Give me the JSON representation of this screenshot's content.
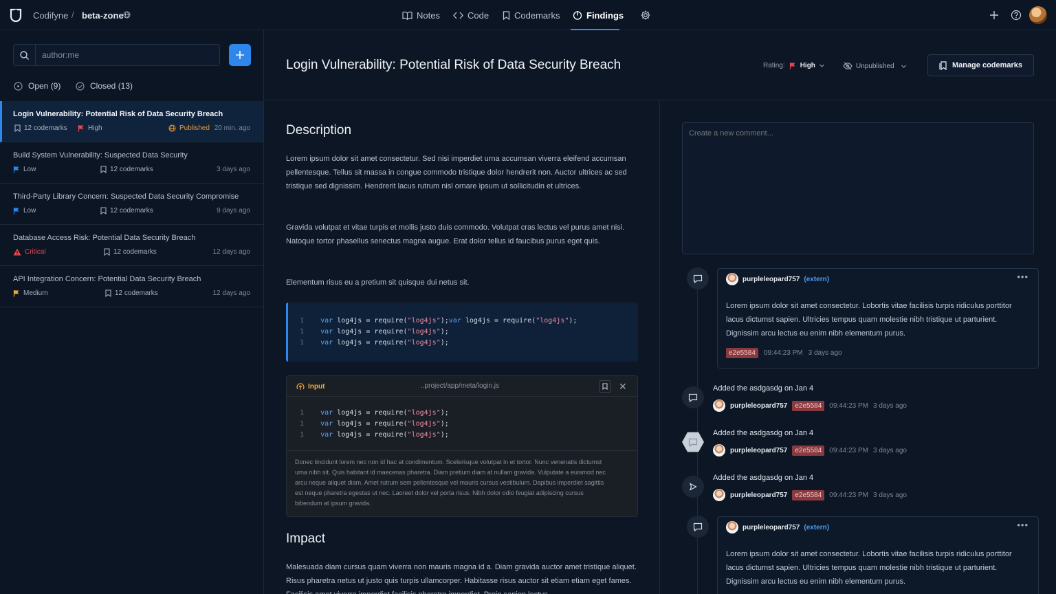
{
  "topbar": {
    "brand": "Codifyne",
    "separator": "/",
    "zone": "beta-zone",
    "nav": [
      {
        "label": "Notes",
        "icon": "book-icon"
      },
      {
        "label": "Code",
        "icon": "code-icon"
      },
      {
        "label": "Codemarks",
        "icon": "bookmark-icon"
      },
      {
        "label": "Findings",
        "icon": "findings-icon",
        "active": true
      }
    ]
  },
  "sidebar": {
    "search_value": "author:me",
    "filters": [
      {
        "label": "Open (9)"
      },
      {
        "label": "Closed (13)"
      }
    ],
    "findings": [
      {
        "title": "Login Vulnerability: Potential Risk of Data Security Breach",
        "codemarks": "12 codemarks",
        "severity": "High",
        "severity_color": "#e5484d",
        "status": "Published",
        "time": "20 min. ago"
      },
      {
        "title": "Build System Vulnerability: Suspected Data Security",
        "severity": "Low",
        "severity_color": "#2f86eb",
        "codemarks": "12 codemarks",
        "time": "3 days ago"
      },
      {
        "title": "Third-Party Library Concern: Suspected Data Security Compromise",
        "severity": "Low",
        "severity_color": "#2f86eb",
        "codemarks": "12 codemarks",
        "time": "9 days ago"
      },
      {
        "title": "Database Access Risk: Potential Data Security Breach",
        "severity": "Critical",
        "severity_color": "#e5484d",
        "codemarks": "12 codemarks",
        "time": "12 days ago"
      },
      {
        "title": "API Integration Concern: Potential Data Security Breach",
        "severity": "Medium",
        "severity_color": "#f2a93b",
        "codemarks": "12 codemarks",
        "time": "12 days ago"
      }
    ]
  },
  "header": {
    "title": "Login Vulnerability: Potential Risk of Data Security Breach",
    "rating_label": "Rating:",
    "rating_value": "High",
    "publish_state": "Unpublished",
    "manage_label": "Manage codemarks"
  },
  "content": {
    "description_heading": "Description",
    "paragraphs": [
      "Lorem ipsum dolor sit amet consectetur. Sed nisi imperdiet urna accumsan viverra eleifend accumsan pellentesque. Tellus sit massa in congue commodo tristique dolor hendrerit non. Auctor ultrices ac sed tristique sed dignissim. Hendrerit lacus rutrum nisl ornare ipsum ut sollicitudin et ultrices.",
      "Gravida volutpat et vitae turpis et mollis justo duis commodo. Volutpat cras lectus vel purus amet nisi. Natoque tortor phasellus senectus magna augue. Erat dolor tellus id faucibus purus eget quis.",
      "Elementum risus eu a pretium sit quisque dui netus sit."
    ],
    "code_lines": [
      {
        "num": "1",
        "kw": "var",
        "rest": " log4js = require(",
        "str": "\"log4js\"",
        "tail": ");",
        "extra_kw": "var",
        "extra_rest": " log4js = require(",
        "extra_str": "\"log4js\"",
        "extra_tail": ");"
      },
      {
        "num": "1",
        "kw": "var",
        "rest": " log4js = require(",
        "str": "\"log4js\"",
        "tail": ");"
      },
      {
        "num": "1",
        "kw": "var",
        "rest": " log4js = require(",
        "str": "\"log4js\"",
        "tail": ");"
      }
    ],
    "input_box": {
      "label": "Input",
      "path": "..project/app/meta/login.js",
      "code_lines": [
        {
          "num": "1",
          "kw": "var",
          "rest": " log4js = require(",
          "str": "\"log4js\"",
          "tail": ");"
        },
        {
          "num": "1",
          "kw": "var",
          "rest": " log4js = require(",
          "str": "\"log4js\"",
          "tail": ");"
        },
        {
          "num": "1",
          "kw": "var",
          "rest": " log4js = require(",
          "str": "\"log4js\"",
          "tail": ");"
        }
      ],
      "note": "Donec tincidunt lorem nec non id hac at condimentum. Scelerisque volutpat in et tortor. Nunc venenatis dictumst urna nibh sit. Quis habitant id maecenas pharetra. Diam pretium diam at nullam gravida. Vulputate a euismod nec arcu neque aliquet diam. Amet rutrum sem pellentesque vel mauris cursus vestibulum. Dapibus imperdiet sagittis est neque pharetra egestas ut nec. Laoreet dolor vel porta risus. Nibh dolor odio feugiat adipiscing cursus bibendum at ipsum gravida."
    },
    "impact_heading": "Impact",
    "impact_text": "Malesuada diam cursus quam viverra non mauris magna id a. Diam gravida auctor amet tristique aliquet. Risus pharetra netus ut justo quis turpis ullamcorper. Habitasse risus auctor sit etiam etiam eget fames. Facilisis amet viverra imperdiet facilisis pharetra imperdiet. Proin sapien lectus."
  },
  "comments": {
    "placeholder": "Create a new comment...",
    "items": [
      {
        "type": "comment",
        "user": "purpleleopard757",
        "tag": "(extern)",
        "text": "Lorem ipsum dolor sit amet consectetur. Lobortis vitae facilisis turpis ridiculus porttitor lacus dictumst sapien. Ultricies tempus quam molestie nibh tristique ut parturient. Dignissim arcu lectus eu enim nibh elementum purus.",
        "commit": "e2e5584",
        "clock": "09:44:23 PM",
        "ago": "3 days ago"
      },
      {
        "type": "activity",
        "title": "Added the asdgasdg on Jan 4",
        "user": "purpleleopard757",
        "commit": "e2e5584",
        "clock": "09:44:23 PM",
        "ago": "3 days ago"
      },
      {
        "type": "activity",
        "title": "Added the asdgasdg on Jan 4",
        "user": "purpleleopard757",
        "commit": "e2e5584",
        "clock": "09:44:23 PM",
        "ago": "3 days ago"
      },
      {
        "type": "activity",
        "title": "Added the asdgasdg on Jan 4",
        "user": "purpleleopard757",
        "commit": "e2e5584",
        "clock": "09:44:23 PM",
        "ago": "3 days ago"
      },
      {
        "type": "comment",
        "user": "purpleleopard757",
        "tag": "(extern)",
        "text": "Lorem ipsum dolor sit amet consectetur. Lobortis vitae facilisis turpis ridiculus porttitor lacus dictumst sapien. Ultricies tempus quam molestie nibh tristique ut parturient. Dignissim arcu lectus eu enim nibh elementum purus."
      }
    ]
  }
}
